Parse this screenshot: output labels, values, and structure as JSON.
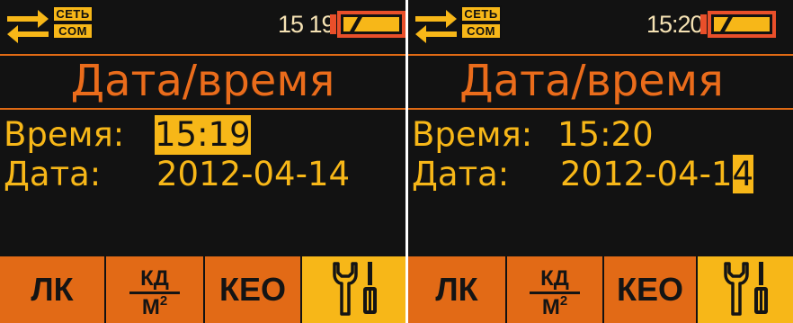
{
  "screens": [
    {
      "status": {
        "net_label": "СЕТЬ",
        "com_label": "COM",
        "clock": "15 19"
      },
      "title": "Дата/время",
      "time": {
        "label": "Время:",
        "value": "15:19"
      },
      "date": {
        "label": "Дата:",
        "value_before_cursor": "2012-04-14",
        "value_cursor": ""
      },
      "softkeys": {
        "k1": "ЛК",
        "k2_num": "КД",
        "k2_den": "М",
        "k2_den_sup": "2",
        "k3": "КЕО"
      }
    },
    {
      "status": {
        "net_label": "СЕТЬ",
        "com_label": "COM",
        "clock": "15:20"
      },
      "title": "Дата/время",
      "time": {
        "label": "Время:",
        "value": "15:20"
      },
      "date": {
        "label": "Дата:",
        "value_before_cursor": "2012-04-1",
        "value_cursor": "4"
      },
      "softkeys": {
        "k1": "ЛК",
        "k2_num": "КД",
        "k2_den": "М",
        "k2_den_sup": "2",
        "k3": "КЕО"
      }
    }
  ],
  "colors": {
    "screen_bg": "#121212",
    "accent_orange": "#e26a16",
    "accent_yellow": "#f7b718",
    "battery_fill": "#e94f2a",
    "clock_text": "#f5e2b4"
  },
  "icons": [
    "arrows-exchange-icon",
    "battery-icon",
    "wrench-screwdriver-icon"
  ]
}
